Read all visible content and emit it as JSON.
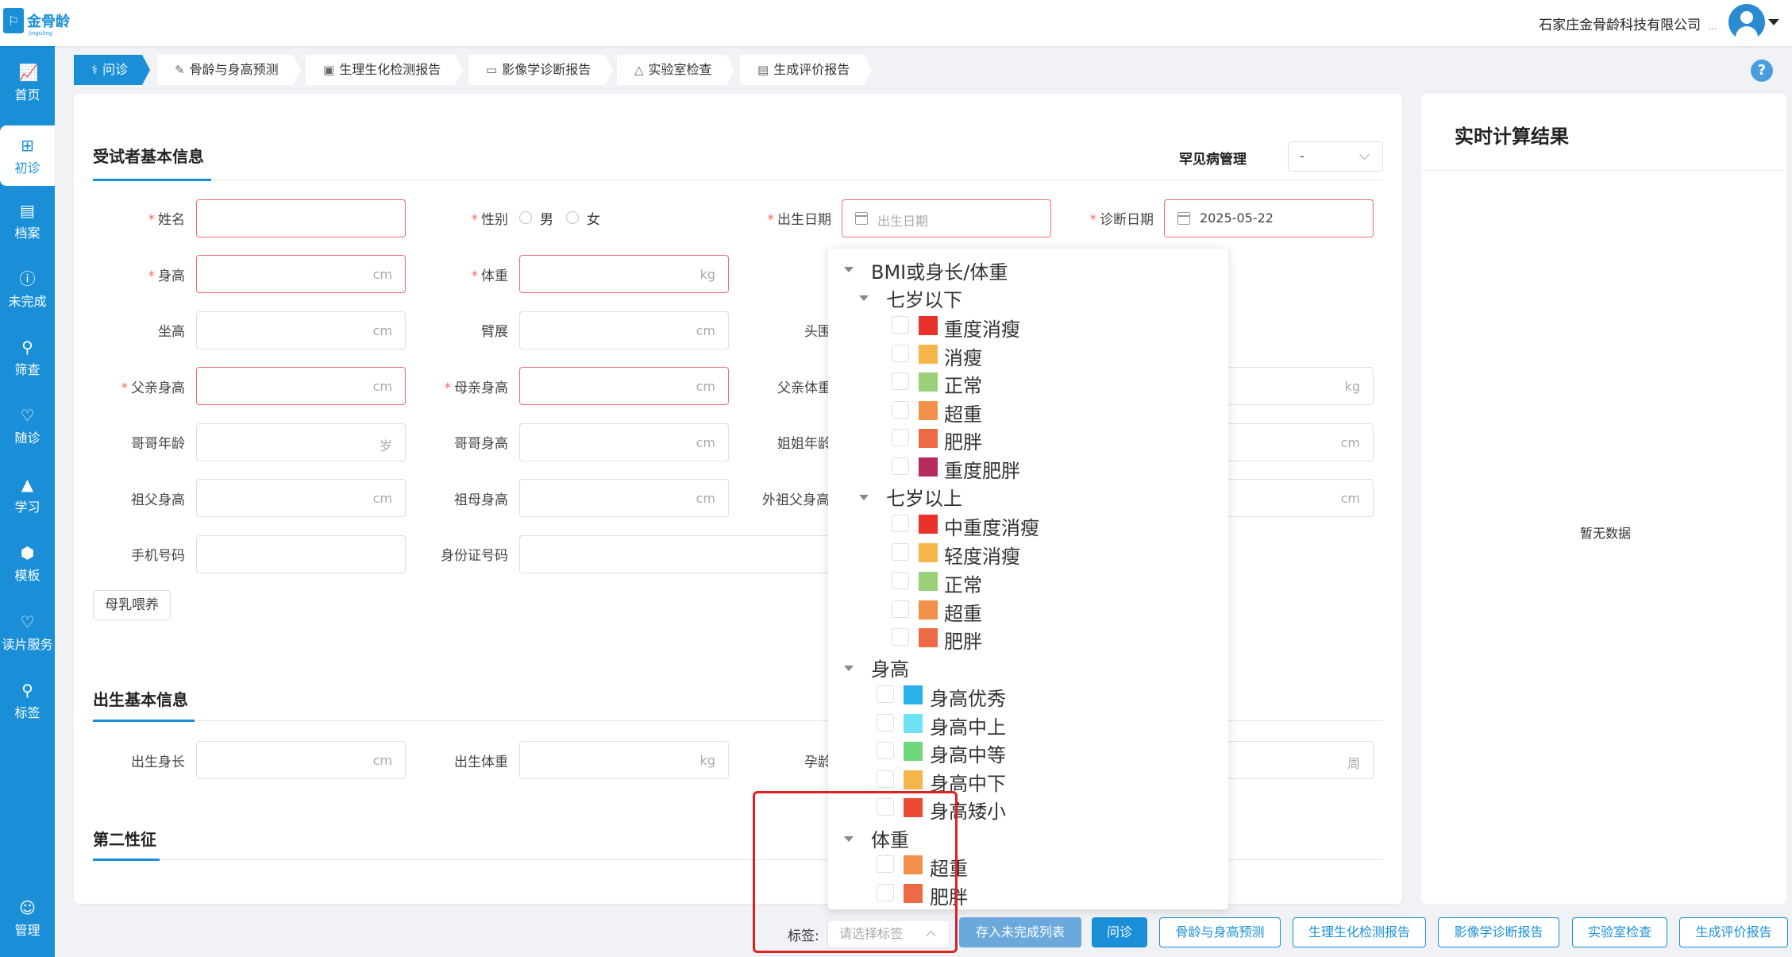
{
  "header": {
    "logo_text": "金骨龄",
    "logo_sub": "jinguling",
    "company": "石家庄金骨龄科技有限公司",
    "company_suffix": "...",
    "accent": "#1a8fd8"
  },
  "sidebar": {
    "items": [
      {
        "label": "首页",
        "icon": "chart-icon"
      },
      {
        "label": "初诊",
        "icon": "plus-square-icon"
      },
      {
        "label": "档案",
        "icon": "archive-icon"
      },
      {
        "label": "未完成",
        "icon": "alert-icon"
      },
      {
        "label": "筛查",
        "icon": "search-doc-icon"
      },
      {
        "label": "随诊",
        "icon": "heart-plus-icon"
      },
      {
        "label": "学习",
        "icon": "graduation-icon"
      },
      {
        "label": "模板",
        "icon": "cube-icon"
      },
      {
        "label": "读片服务",
        "icon": "heart-icon"
      },
      {
        "label": "标签",
        "icon": "tag-icon"
      },
      {
        "label": "管理",
        "icon": "user-icon"
      }
    ]
  },
  "tabs": [
    {
      "label": "问诊",
      "icon": "stethoscope-icon"
    },
    {
      "label": "骨龄与身高预测",
      "icon": "pen-icon"
    },
    {
      "label": "生理生化检测报告",
      "icon": "image-icon"
    },
    {
      "label": "影像学诊断报告",
      "icon": "monitor-icon"
    },
    {
      "label": "实验室检查",
      "icon": "flask-icon"
    },
    {
      "label": "生成评价报告",
      "icon": "doc-icon"
    }
  ],
  "help_label": "?",
  "basic": {
    "title": "受试者基本信息",
    "rare_label": "罕见病管理",
    "rare_value": "-",
    "name_label": "姓名",
    "gender_label": "性别",
    "male": "男",
    "female": "女",
    "birth_label": "出生日期",
    "birth_placeholder": "出生日期",
    "diag_label": "诊断日期",
    "diag_value": "2025-05-22",
    "height_label": "身高",
    "weight_label": "体重",
    "sitting_label": "坐高",
    "arm_label": "臂展",
    "head_label": "头围",
    "father_h_label": "父亲身高",
    "mother_h_label": "母亲身高",
    "father_w_label": "父亲体重",
    "brother_age_label": "哥哥年龄",
    "brother_h_label": "哥哥身高",
    "sister_age_label": "姐姐年龄",
    "grandpa_label": "祖父身高",
    "grandma_label": "祖母身高",
    "maternal_grandpa_label": "外祖父身高",
    "phone_label": "手机号码",
    "id_label": "身份证号码",
    "breastfeed_button": "母乳喂养",
    "unit_cm": "cm",
    "unit_kg": "kg",
    "unit_age": "岁"
  },
  "birth": {
    "title": "出生基本信息",
    "length_label": "出生身长",
    "weight_label": "出生体重",
    "gest_label": "孕龄",
    "unit_week": "周"
  },
  "secondary": {
    "title": "第二性征"
  },
  "realtime": {
    "title": "实时计算结果",
    "empty": "暂无数据"
  },
  "tag_tree": {
    "groups": [
      {
        "label": "BMI或身长/体重",
        "subgroups": [
          {
            "label": "七岁以下",
            "items": [
              {
                "label": "重度消瘦",
                "color": "#e8322a"
              },
              {
                "label": "消瘦",
                "color": "#f5b54a"
              },
              {
                "label": "正常",
                "color": "#9bd07a"
              },
              {
                "label": "超重",
                "color": "#f2924a"
              },
              {
                "label": "肥胖",
                "color": "#ec6a44"
              },
              {
                "label": "重度肥胖",
                "color": "#b62a5e"
              }
            ]
          },
          {
            "label": "七岁以上",
            "items": [
              {
                "label": "中重度消瘦",
                "color": "#e8322a"
              },
              {
                "label": "轻度消瘦",
                "color": "#f5b54a"
              },
              {
                "label": "正常",
                "color": "#9bd07a"
              },
              {
                "label": "超重",
                "color": "#f2924a"
              },
              {
                "label": "肥胖",
                "color": "#ec6a44"
              }
            ]
          }
        ]
      },
      {
        "label": "身高",
        "items": [
          {
            "label": "身高优秀",
            "color": "#2bb0ea"
          },
          {
            "label": "身高中上",
            "color": "#6ee2f2"
          },
          {
            "label": "身高中等",
            "color": "#6ed87a"
          },
          {
            "label": "身高中下",
            "color": "#f5b54a"
          },
          {
            "label": "身高矮小",
            "color": "#ec4a34"
          }
        ]
      },
      {
        "label": "体重",
        "items": [
          {
            "label": "超重",
            "color": "#f2924a"
          },
          {
            "label": "肥胖",
            "color": "#ec6a44"
          }
        ]
      }
    ]
  },
  "bottom": {
    "tag_label": "标签:",
    "tag_placeholder": "请选择标签",
    "save_unfinished": "存入未完成列表",
    "consult": "问诊",
    "bone_age": "骨龄与身高预测",
    "biochem": "生理生化检测报告",
    "imaging": "影像学诊断报告",
    "lab": "实验室检查",
    "eval": "生成评价报告"
  }
}
